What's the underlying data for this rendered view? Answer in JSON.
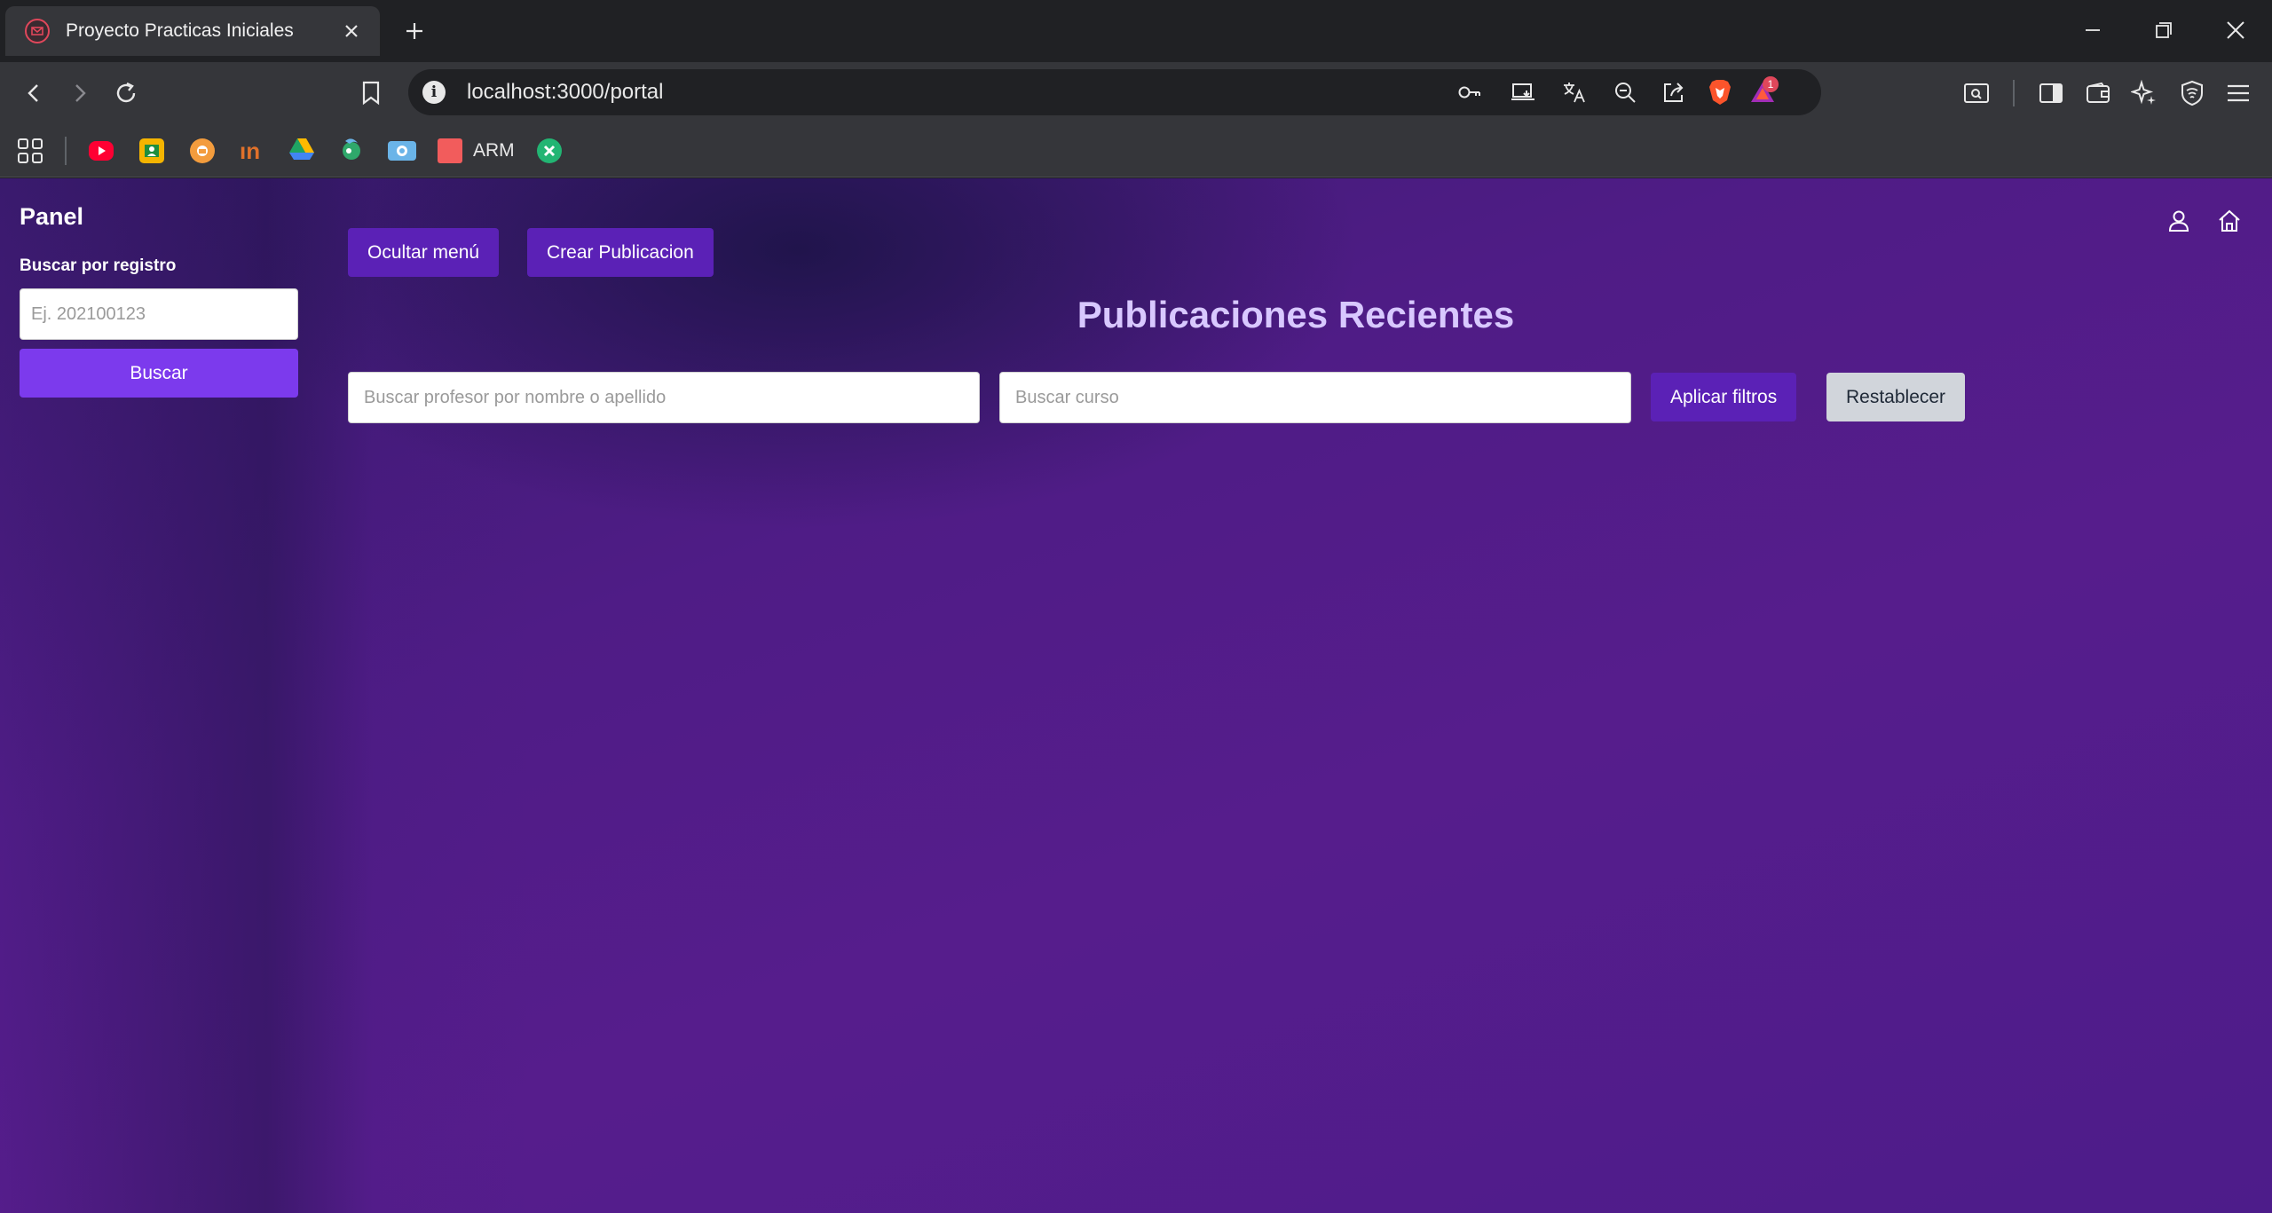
{
  "browser": {
    "tab_title": "Proyecto Practicas Iniciales",
    "url": "localhost:3000/portal",
    "notification_count": "1",
    "bookmarks": [
      {
        "label": "",
        "icon": "youtube-icon",
        "color": "#ff0033"
      },
      {
        "label": "",
        "icon": "classroom-icon",
        "color": "#f4b400"
      },
      {
        "label": "",
        "icon": "bookmark-icon-3",
        "color": "#f39c3d"
      },
      {
        "label": "",
        "icon": "bookmark-icon-4",
        "color": "#e0712a"
      },
      {
        "label": "",
        "icon": "google-drive-icon",
        "color": "#1fa463"
      },
      {
        "label": "",
        "icon": "bookmark-icon-6",
        "color": "#2fa86b"
      },
      {
        "label": "",
        "icon": "bookmark-icon-7",
        "color": "#6ab4e8"
      },
      {
        "label": "ARM",
        "icon": "arm-icon",
        "color": "#f25c5c"
      },
      {
        "label": "",
        "icon": "bookmark-icon-9",
        "color": "#22b573"
      }
    ]
  },
  "sidebar": {
    "title": "Panel",
    "search_label": "Buscar por registro",
    "search_placeholder": "Ej. 202100123",
    "search_button": "Buscar"
  },
  "main": {
    "hide_menu_button": "Ocultar menú",
    "create_post_button": "Crear Publicacion",
    "heading": "Publicaciones Recientes",
    "professor_placeholder": "Buscar profesor por nombre o apellido",
    "course_placeholder": "Buscar curso",
    "apply_filters_button": "Aplicar filtros",
    "reset_button": "Restablecer"
  },
  "colors": {
    "accent": "#7c3aed",
    "button_dark": "#5b21b6",
    "heading": "#d8c8ff",
    "background": "#4f1c86"
  }
}
